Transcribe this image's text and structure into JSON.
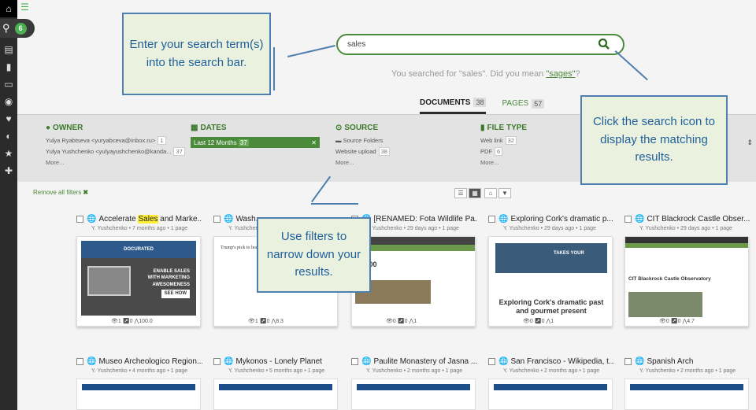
{
  "sidebar": {
    "attach_count": "6"
  },
  "search": {
    "value": "sales"
  },
  "suggestion": {
    "prefix": "You searched for \"sales\". Did you mean ",
    "suggest": "\"sages\"",
    "suffix": "?"
  },
  "tabs": [
    {
      "label": "DOCUMENTS",
      "count": "38"
    },
    {
      "label": "PAGES",
      "count": "57"
    }
  ],
  "filters": {
    "owner": {
      "title": "OWNER",
      "items": [
        {
          "text": "Yulya Ryabtseva <yuryabceva@inbox.ru>",
          "count": "1"
        },
        {
          "text": "Yulya Yushchenko <yulyayushchenko@kanda...",
          "count": "37"
        }
      ],
      "more": "More..."
    },
    "dates": {
      "title": "DATES",
      "chip": "Last 12 Months",
      "count": "37"
    },
    "source": {
      "title": "SOURCE",
      "items": [
        {
          "text": "Source Folders",
          "count": ""
        },
        {
          "text": "Website upload",
          "count": "38"
        }
      ],
      "more": "More..."
    },
    "filetype": {
      "title": "FILE TYPE",
      "items": [
        {
          "text": "Web link",
          "count": "32"
        },
        {
          "text": "PDF",
          "count": "6"
        }
      ],
      "more": "More..."
    }
  },
  "remove_all": "Remove all filters",
  "cards": [
    {
      "title_pre": "Accelerate ",
      "title_hl": "Sales",
      "title_post": " and Marke...",
      "meta": "Y. Yushchenko • 7 months ago • 1 page",
      "stats": "👁1 ↗0 ⋀100.0",
      "thumb": "docurated"
    },
    {
      "title_pre": "Wash...",
      "title_hl": "",
      "title_post": "",
      "meta": "Y. Yushchenko",
      "stats": "👁1 ↗0 ⋀8.3",
      "thumb": "article"
    },
    {
      "title_pre": "[RENAMED: Fota Wildlife Pa...",
      "title_hl": "",
      "title_post": "",
      "meta": "Y. Yushchenko • 29 days ago • 1 page",
      "stats": "👁0 ↗0 ⋀1",
      "thumb": "web"
    },
    {
      "title_pre": "Exploring Cork's dramatic p...",
      "title_hl": "",
      "title_post": "",
      "meta": "Y. Yushchenko • 29 days ago • 1 page",
      "stats": "👁0 ↗0 ⋀1",
      "thumb": "cork"
    },
    {
      "title_pre": "CIT Blackrock Castle Obser...",
      "title_hl": "",
      "title_post": "",
      "meta": "Y. Yushchenko • 29 days ago • 1 page",
      "stats": "👁0 ↗0 ⋀4.7",
      "thumb": "castle"
    },
    {
      "title_pre": "Museo Archeologico Region...",
      "title_hl": "",
      "title_post": "",
      "meta": "Y. Yushchenko • 4 months ago • 1 page",
      "stats": "",
      "thumb": ""
    },
    {
      "title_pre": "Mykonos - Lonely Planet",
      "title_hl": "",
      "title_post": "",
      "meta": "Y. Yushchenko • 5 months ago • 1 page",
      "stats": "",
      "thumb": ""
    },
    {
      "title_pre": "Paulite Monastery of Jasna ...",
      "title_hl": "",
      "title_post": "",
      "meta": "Y. Yushchenko • 2 months ago • 1 page",
      "stats": "",
      "thumb": ""
    },
    {
      "title_pre": "San Francisco - Wikipedia, t...",
      "title_hl": "",
      "title_post": "",
      "meta": "Y. Yushchenko • 2 months ago • 1 page",
      "stats": "",
      "thumb": ""
    },
    {
      "title_pre": "Spanish Arch",
      "title_hl": "",
      "title_post": "",
      "meta": "Y. Yushchenko • 2 months ago • 1 page",
      "stats": "",
      "thumb": ""
    }
  ],
  "thumb_text": {
    "docurated_brand": "DOCURATED",
    "docurated_line1": "ENABLE SALES",
    "docurated_line2": "WITH MARKETING",
    "docurated_line3": "AWESOMENESS",
    "docurated_cta": "SEE HOW",
    "article_headline": "Trump's pick to lead EPA is part of ongoing the agency",
    "fota_count": "50.000",
    "cork_headline": "Exploring Cork's dramatic past and gourmet present",
    "cork_banner": "TAKES YOUR",
    "castle_title": "CIT Blackrock Castle Observatory"
  },
  "callouts": {
    "search": "Enter your search term(s) into the search bar.",
    "icon": "Click the search icon to display the matching results.",
    "filters": "Use filters to narrow down your results."
  }
}
